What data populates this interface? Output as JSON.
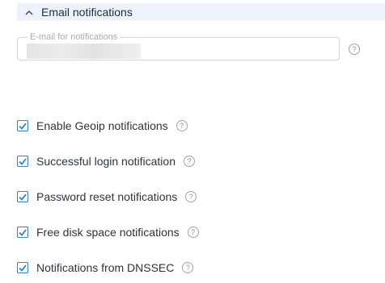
{
  "section": {
    "title": "Email notifications",
    "collapse_icon": "chevron-up-icon"
  },
  "email": {
    "legend": "E-mail for notifications",
    "value_masked": true,
    "help_icon": "help-circle-icon",
    "help_glyph": "?"
  },
  "options": [
    {
      "label": "Enable Geoip notifications",
      "checked": true
    },
    {
      "label": "Successful login notification",
      "checked": true
    },
    {
      "label": "Password reset notifications",
      "checked": true
    },
    {
      "label": "Free disk space notifications",
      "checked": true
    },
    {
      "label": "Notifications from DNSSEC",
      "checked": true
    }
  ],
  "colors": {
    "accent": "#2f80d1",
    "header_bg": "#eef3fb",
    "text": "#2b3440",
    "muted": "#a3acb8"
  }
}
